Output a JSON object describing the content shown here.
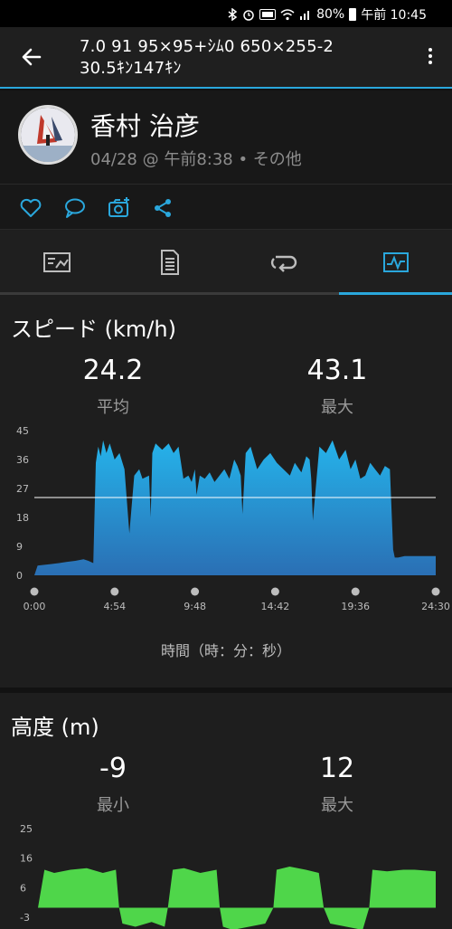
{
  "status": {
    "time": "午前 10:45",
    "battery": "80%"
  },
  "appbar": {
    "title_line1": "7.0 91 95×95+ｼﾑ0 650×255-2",
    "title_line2": "30.5ｷﾝ147ｷﾝ"
  },
  "profile": {
    "name": "香村 治彦",
    "meta": "04/28 @ 午前8:38 • その他"
  },
  "speed": {
    "title": "スピード (km/h)",
    "avg_value": "24.2",
    "avg_label": "平均",
    "max_value": "43.1",
    "max_label": "最大",
    "x_axis_title": "時間（時：分：秒）"
  },
  "altitude": {
    "title": "高度 (m)",
    "min_value": "-9",
    "min_label": "最小",
    "max_value": "12",
    "max_label": "最大"
  },
  "colors": {
    "accent": "#2aa7dc",
    "speed_fill": "#2b9fd8",
    "alt_fill": "#4fd64a"
  },
  "chart_data": [
    {
      "type": "area",
      "ylim": [
        0,
        45
      ],
      "yticks": [
        "45",
        "36",
        "27",
        "18",
        "9",
        "0"
      ],
      "xticks": [
        "0:00",
        "4:54",
        "9:48",
        "14:42",
        "19:36",
        "24:30"
      ],
      "avg_line": 24.2,
      "x": [
        0,
        0.2,
        0.5,
        1,
        1.5,
        2,
        2.5,
        3,
        3.3,
        3.6,
        3.75,
        3.9,
        4.05,
        4.2,
        4.4,
        4.6,
        4.9,
        5.2,
        5.5,
        5.8,
        6.1,
        6.4,
        6.6,
        7,
        7.1,
        7.2,
        7.4,
        7.8,
        8.2,
        8.5,
        8.8,
        9.1,
        9.4,
        9.6,
        9.8,
        9.9,
        10.1,
        10.4,
        10.7,
        11,
        11.3,
        11.6,
        11.9,
        12.2,
        12.4,
        12.6,
        12.7,
        12.9,
        13.2,
        13.6,
        14,
        14.4,
        14.8,
        15.2,
        15.6,
        15.9,
        16.3,
        16.6,
        16.8,
        16.9,
        17,
        17.4,
        17.8,
        18.2,
        18.6,
        19,
        19.3,
        19.6,
        19.9,
        20.2,
        20.5,
        20.8,
        21.1,
        21.4,
        21.7,
        21.9,
        22,
        22.2,
        22.6,
        23.2,
        24.5
      ],
      "y": [
        0,
        3,
        3.2,
        3.5,
        3.8,
        4.2,
        4.5,
        5,
        4.5,
        3.8,
        35,
        40,
        37,
        42,
        38,
        41,
        36,
        38,
        33,
        13,
        31,
        33,
        30,
        31,
        18,
        38,
        41,
        39,
        41,
        38,
        40,
        30,
        31,
        29,
        33,
        25,
        31,
        30,
        32,
        29,
        31,
        33,
        30,
        36,
        34,
        31,
        19,
        38,
        40,
        33,
        36,
        38,
        35,
        33,
        31,
        35,
        32,
        37,
        36,
        30,
        17,
        40,
        38,
        42,
        36,
        39,
        33,
        36,
        30,
        31,
        35,
        33,
        31,
        34,
        33,
        8,
        5.5,
        5.5,
        6,
        6,
        6
      ]
    },
    {
      "type": "area",
      "ylim": [
        -3,
        25
      ],
      "yticks": [
        "25",
        "16",
        "6",
        "-3"
      ],
      "x": [
        0,
        0.4,
        1,
        2,
        3,
        4,
        4.8,
        5,
        5.2,
        6,
        7,
        7.8,
        8,
        8.3,
        9,
        10,
        11,
        11.2,
        11.4,
        12,
        13,
        14,
        14.5,
        14.7,
        15.5,
        16.5,
        17.3,
        17.6,
        18,
        19,
        20,
        20.4,
        20.6,
        21.5,
        22.5,
        23.2,
        24.5
      ],
      "y": [
        0,
        12,
        11,
        12,
        12.5,
        11,
        12,
        0,
        -5,
        -6,
        -4.5,
        -6,
        0,
        12,
        12.5,
        11,
        12,
        0,
        -6,
        -7,
        -6,
        -5,
        0,
        12,
        13,
        12,
        11,
        0,
        -5,
        -6,
        -7,
        0,
        12,
        11.5,
        12,
        12,
        11.5
      ]
    }
  ]
}
